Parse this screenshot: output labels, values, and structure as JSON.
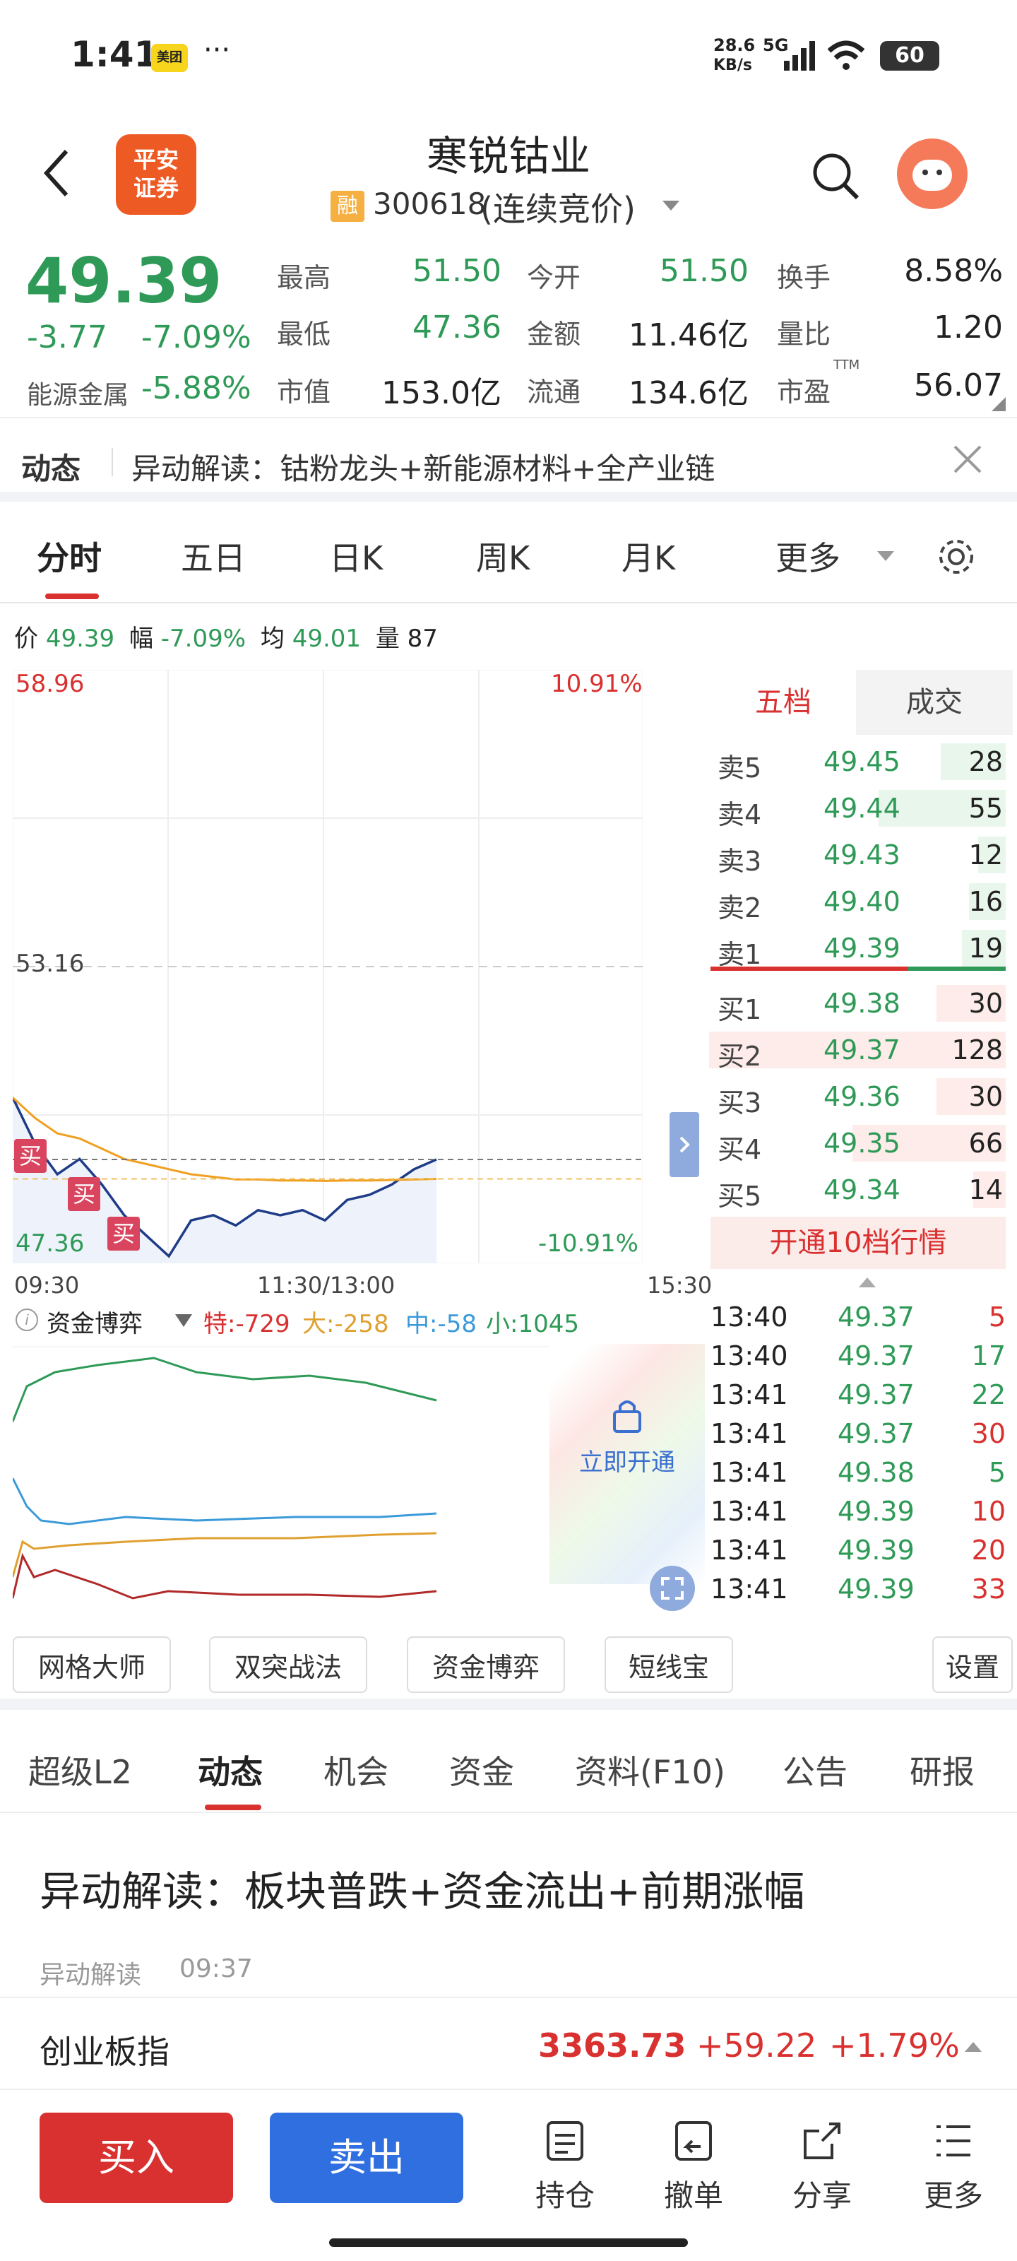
{
  "status": {
    "time": "1:41",
    "app_badge": "美团",
    "dots": "···",
    "net_speed": "28.6",
    "net_unit": "KB/s",
    "net_type": "5G",
    "battery": "60"
  },
  "header": {
    "title": "寒锐钴业",
    "broker_logo": "平安\n证券",
    "margin_badge": "融",
    "code_text": "300618",
    "status_text": "(连续竞价)"
  },
  "quote": {
    "price": "49.39",
    "change": "-3.77",
    "change_pct": "-7.09%",
    "sector": "能源金属",
    "sector_pct": "-5.88%",
    "high_label": "最高",
    "high": "51.50",
    "open_label": "今开",
    "open": "51.50",
    "turnover_label": "换手",
    "turnover": "8.58%",
    "low_label": "最低",
    "low": "47.36",
    "amount_label": "金额",
    "amount": "11.46亿",
    "vol_ratio_label": "量比",
    "vol_ratio": "1.20",
    "mcap_label": "市值",
    "mcap": "153.0亿",
    "float_label": "流通",
    "float": "134.6亿",
    "pe_label": "市盈",
    "pe_sup": "TTM",
    "pe": "56.07"
  },
  "dynamic": {
    "label": "动态",
    "text": "异动解读：钴粉龙头+新能源材料+全产业链"
  },
  "chart_tabs": [
    "分时",
    "五日",
    "日K",
    "周K",
    "月K",
    "更多"
  ],
  "intraday": {
    "price_label": "价",
    "price": "49.39",
    "amp_label": "幅",
    "amp": "-7.09%",
    "avg_label": "均",
    "avg": "49.01",
    "vol_label": "量",
    "vol": "87",
    "y_top": "58.96",
    "y_mid": "53.16",
    "y_bot": "47.36",
    "pct_top": "10.91%",
    "pct_bot": "-10.91%",
    "x_start": "09:30",
    "x_mid": "11:30/13:00",
    "x_end": "15:30",
    "buy_mark": "买"
  },
  "chart_data": {
    "type": "line",
    "x": [
      "09:30",
      "09:33",
      "09:36",
      "09:40",
      "09:45",
      "09:50",
      "09:55",
      "10:00",
      "10:10",
      "10:20",
      "10:30",
      "10:45",
      "11:00",
      "11:15",
      "11:30",
      "13:05",
      "13:15",
      "13:25",
      "13:35",
      "13:41"
    ],
    "series": [
      {
        "values": [
          50.6,
          49.7,
          49.1,
          49.4,
          48.9,
          48.3,
          47.9,
          47.5,
          48.2,
          48.3,
          48.1,
          48.4,
          48.3,
          48.4,
          48.2,
          48.6,
          48.7,
          48.9,
          49.2,
          49.39
        ]
      },
      {
        "values": [
          50.6,
          50.2,
          49.9,
          49.8,
          49.6,
          49.4,
          49.3,
          49.2,
          49.1,
          49.05,
          49.0,
          49.0,
          48.98,
          48.98,
          48.97,
          48.98,
          48.98,
          48.99,
          49.0,
          49.01
        ]
      }
    ],
    "ylim": [
      47.36,
      58.96
    ]
  },
  "order_book": {
    "tab_five": "五档",
    "tab_trade": "成交",
    "asks": [
      {
        "label": "卖5",
        "price": "49.45",
        "vol": "28"
      },
      {
        "label": "卖4",
        "price": "49.44",
        "vol": "55"
      },
      {
        "label": "卖3",
        "price": "49.43",
        "vol": "12"
      },
      {
        "label": "卖2",
        "price": "49.40",
        "vol": "16"
      },
      {
        "label": "卖1",
        "price": "49.39",
        "vol": "19"
      }
    ],
    "bids": [
      {
        "label": "买1",
        "price": "49.38",
        "vol": "30"
      },
      {
        "label": "买2",
        "price": "49.37",
        "vol": "128"
      },
      {
        "label": "买3",
        "price": "49.36",
        "vol": "30"
      },
      {
        "label": "买4",
        "price": "49.35",
        "vol": "66"
      },
      {
        "label": "买5",
        "price": "49.34",
        "vol": "14"
      }
    ],
    "open10": "开通10档行情"
  },
  "ticks": [
    {
      "t": "13:40",
      "p": "49.37",
      "v": "5"
    },
    {
      "t": "13:40",
      "p": "49.37",
      "v": "17"
    },
    {
      "t": "13:41",
      "p": "49.37",
      "v": "22"
    },
    {
      "t": "13:41",
      "p": "49.37",
      "v": "30"
    },
    {
      "t": "13:41",
      "p": "49.38",
      "v": "5"
    },
    {
      "t": "13:41",
      "p": "49.39",
      "v": "10"
    },
    {
      "t": "13:41",
      "p": "49.39",
      "v": "20"
    },
    {
      "t": "13:41",
      "p": "49.39",
      "v": "33"
    }
  ],
  "fund": {
    "label": "资金博弈",
    "te": "特:-729",
    "da": "大:-258",
    "zhong": "中:-58",
    "xiao": "小:1045",
    "unlock": "立即开通"
  },
  "tools": {
    "grid": "网格大师",
    "dual": "双突战法",
    "fund": "资金博弈",
    "short": "短线宝",
    "settings": "设置"
  },
  "tabs2": [
    "超级L2",
    "动态",
    "机会",
    "资金",
    "资料(F10)",
    "公告",
    "研报"
  ],
  "news": {
    "headline": "异动解读：板块普跌+资金流出+前期涨幅",
    "tag": "异动解读",
    "time": "09:37"
  },
  "index": {
    "name": "创业板指",
    "value": "3363.73",
    "change": "+59.22",
    "pct": "+1.79%"
  },
  "bottom": {
    "buy": "买入",
    "sell": "卖出",
    "hold": "持仓",
    "cancel": "撤单",
    "share": "分享",
    "more": "更多"
  },
  "colors": {
    "up": "#d93030",
    "down": "#2f9a57",
    "buy_btn": "#d93030",
    "sell_btn": "#2f6fe0"
  }
}
